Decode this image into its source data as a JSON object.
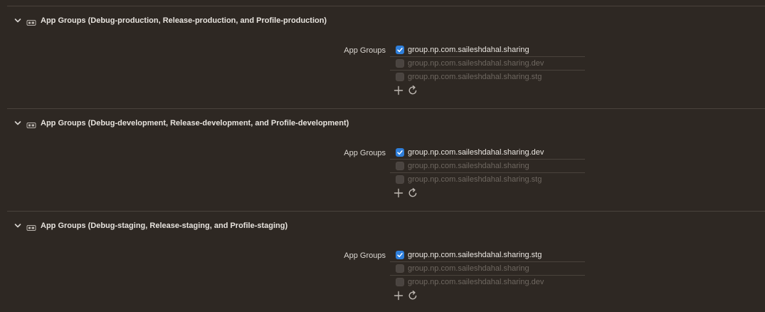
{
  "sections": [
    {
      "title": "App Groups (Debug-production, Release-production, and Profile-production)",
      "field_label": "App Groups",
      "groups": [
        {
          "name": "group.np.com.saileshdahal.sharing",
          "checked": true
        },
        {
          "name": "group.np.com.saileshdahal.sharing.dev",
          "checked": false
        },
        {
          "name": "group.np.com.saileshdahal.sharing.stg",
          "checked": false
        }
      ]
    },
    {
      "title": "App Groups (Debug-development, Release-development, and Profile-development)",
      "field_label": "App Groups",
      "groups": [
        {
          "name": "group.np.com.saileshdahal.sharing.dev",
          "checked": true
        },
        {
          "name": "group.np.com.saileshdahal.sharing",
          "checked": false
        },
        {
          "name": "group.np.com.saileshdahal.sharing.stg",
          "checked": false
        }
      ]
    },
    {
      "title": "App Groups (Debug-staging, Release-staging, and Profile-staging)",
      "field_label": "App Groups",
      "groups": [
        {
          "name": "group.np.com.saileshdahal.sharing.stg",
          "checked": true
        },
        {
          "name": "group.np.com.saileshdahal.sharing",
          "checked": false
        },
        {
          "name": "group.np.com.saileshdahal.sharing.dev",
          "checked": false
        }
      ]
    }
  ],
  "icons": {
    "disclosure": "chevron-down-icon",
    "capability": "capability-icon",
    "add": "plus-icon",
    "refresh": "refresh-icon",
    "check": "checkmark-icon"
  },
  "colors": {
    "background": "#2e2823",
    "accent": "#2f7fdb",
    "separator": "#4a433c",
    "text": "#e7e3de",
    "disabled_text": "#6e6760"
  }
}
